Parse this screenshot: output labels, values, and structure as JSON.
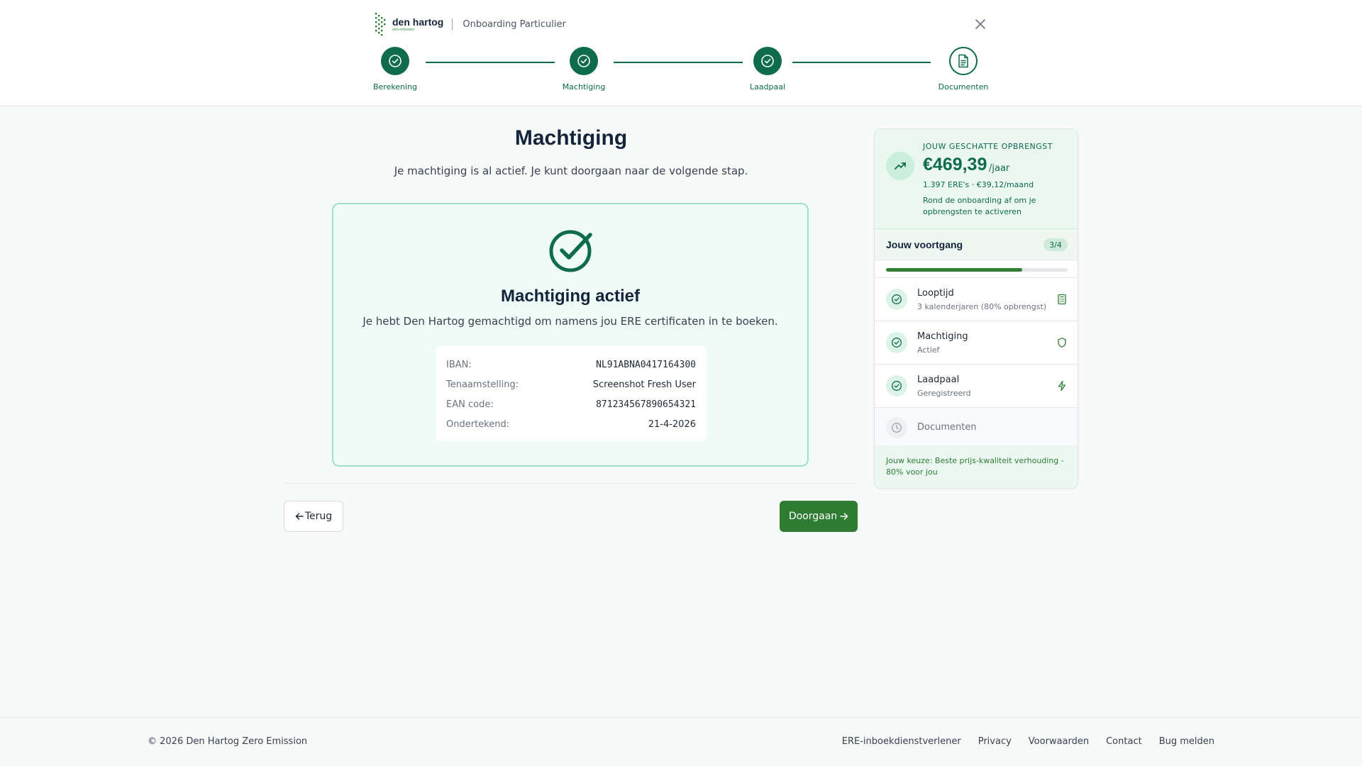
{
  "header": {
    "brand_name": "den hartog",
    "brand_sub": "zero-emission",
    "title": "Onboarding Particulier"
  },
  "steps": [
    {
      "label": "Berekening",
      "state": "done"
    },
    {
      "label": "Machtiging",
      "state": "done"
    },
    {
      "label": "Laadpaal",
      "state": "done"
    },
    {
      "label": "Documenten",
      "state": "current"
    }
  ],
  "main": {
    "title": "Machtiging",
    "subtitle": "Je machtiging is al actief. Je kunt doorgaan naar de volgende stap.",
    "card": {
      "title": "Machtiging actief",
      "description": "Je hebt Den Hartog gemachtigd om namens jou ERE certificaten in te boeken.",
      "details": [
        {
          "label": "IBAN:",
          "value": "NL91ABNA0417164300"
        },
        {
          "label": "Tenaamstelling:",
          "value": "Screenshot Fresh User"
        },
        {
          "label": "EAN code:",
          "value": "871234567890654321"
        },
        {
          "label": "Ondertekend:",
          "value": "21-4-2026"
        }
      ]
    },
    "back_label": "Terug",
    "next_label": "Doorgaan"
  },
  "sidebar": {
    "earn_kicker": "JOUW GESCHATTE OPBRENGST",
    "earn_amount": "€469,39",
    "earn_unit": "/jaar",
    "earn_detail": "1.397 ERE's · €39,12/maand",
    "earn_note": "Rond de onboarding af om je opbrengsten te activeren",
    "progress_title": "Jouw voortgang",
    "progress_badge": "3/4",
    "progress_fraction": 0.75,
    "items": [
      {
        "title": "Looptijd",
        "subtitle": "3 kalenderjaren (80% opbrengst)",
        "icon": "calculator-icon"
      },
      {
        "title": "Machtiging",
        "subtitle": "Actief",
        "icon": "shield-icon"
      },
      {
        "title": "Laadpaal",
        "subtitle": "Geregistreerd",
        "icon": "lightning-icon"
      },
      {
        "title": "Documenten",
        "subtitle": "",
        "icon": "clock-icon"
      }
    ],
    "choice_note": "Jouw keuze: Beste prijs-kwaliteit verhouding - 80% voor jou"
  },
  "footer": {
    "copyright": "© 2026 Den Hartog Zero Emission",
    "links": [
      "ERE-inboekdienstverlener",
      "Privacy",
      "Voorwaarden",
      "Contact",
      "Bug melden"
    ]
  },
  "colors": {
    "brand_green": "#0e6b4b",
    "button_green": "#2e7d32",
    "card_bg": "#effbf6",
    "card_border": "#9fe1c6"
  }
}
